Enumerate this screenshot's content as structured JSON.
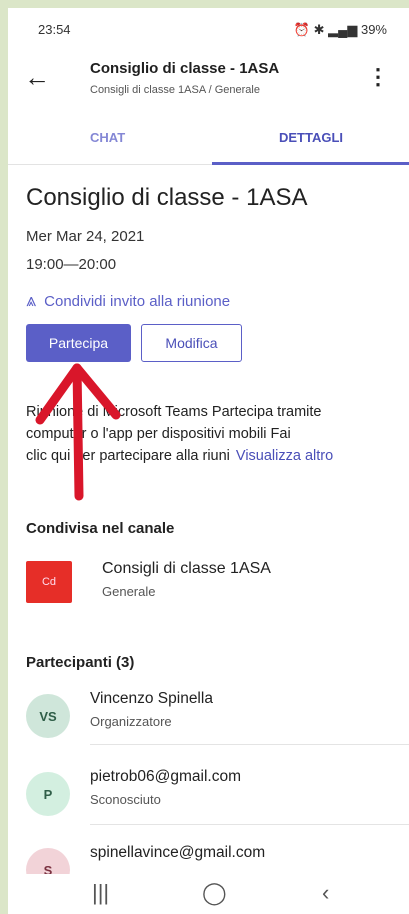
{
  "status_bar": {
    "time": "23:54",
    "battery": "39%"
  },
  "header": {
    "title": "Consiglio di classe - 1ASA",
    "breadcrumb": "Consigli di classe 1ASA / Generale"
  },
  "tabs": [
    {
      "label": "CHAT"
    },
    {
      "label": "DETTAGLI",
      "active": true
    }
  ],
  "meeting": {
    "title": "Consiglio di classe - 1ASA",
    "date": "Mer Mar 24, 2021",
    "time": "19:00—20:00",
    "share_label": "Condividi invito alla riunione",
    "join_label": "Partecipa",
    "edit_label": "Modifica",
    "description_line1": "Riunione di Microsoft Teams Partecipa tramite",
    "description_line2": "computer o l'app per dispositivi mobili Fai",
    "description_line3": "clic qui per partecipare alla riuni",
    "see_more": "Visualizza altro"
  },
  "channel_section": {
    "heading": "Condivisa nel canale",
    "avatar_text": "Cd",
    "name": "Consigli di classe 1ASA",
    "sub": "Generale"
  },
  "participants_section": {
    "heading": "Partecipanti (3)",
    "people": [
      {
        "initials": "VS",
        "name": "Vincenzo Spinella",
        "role": "Organizzatore"
      },
      {
        "initials": "P",
        "name": "pietrob06@gmail.com",
        "role": "Sconosciuto"
      },
      {
        "initials": "S",
        "name": "spinellavince@gmail.com",
        "role": ""
      }
    ]
  },
  "icons": {
    "back": "arrow-left-icon",
    "more": "more-vertical-icon",
    "share": "share-icon",
    "nav": [
      "recents-icon",
      "home-icon",
      "back-nav-icon"
    ]
  },
  "colors": {
    "accent": "#5b5fc7",
    "channel_avatar": "#e62e28",
    "annotation_arrow": "#d9162a"
  }
}
